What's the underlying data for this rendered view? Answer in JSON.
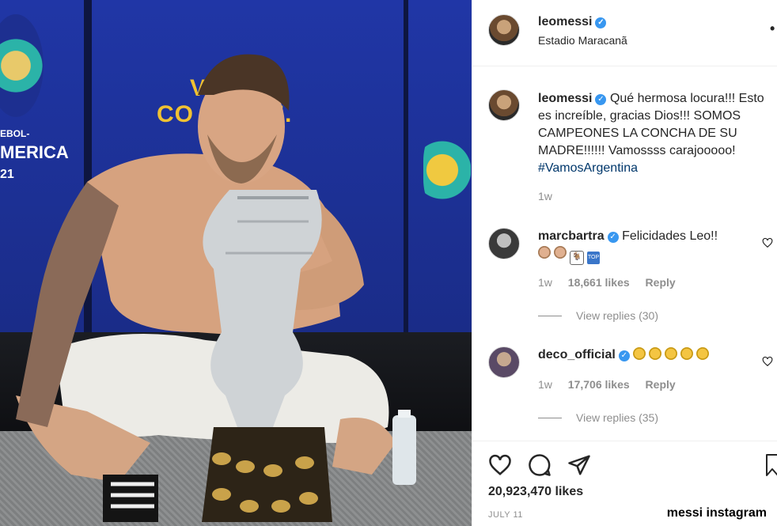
{
  "post": {
    "username": "leomessi",
    "location": "Estadio Maracanã",
    "more_glyph": "•"
  },
  "photo": {
    "banner_left": "V_",
    "banner_main": "CO        TE.",
    "logo_line1": "EBOL-",
    "logo_line2": "MERICA",
    "logo_line3": "21"
  },
  "caption": {
    "username": "leomessi",
    "text": "Qué hermosa locura!!! Esto es increíble, gracias Dios!!! SOMOS CAMPEONES LA CONCHA DE SU MADRE!!!!!! Vamossss carajooooo!",
    "hashtag": "#VamosArgentina",
    "age": "1w"
  },
  "comments": [
    {
      "username": "marcbartra",
      "text": "Felicidades Leo!!",
      "age": "1w",
      "likes": "18,661 likes",
      "reply": "Reply",
      "view_replies": "View replies (30)"
    },
    {
      "username": "deco_official",
      "text": "",
      "age": "1w",
      "likes": "17,706 likes",
      "reply": "Reply",
      "view_replies": "View replies (35)"
    }
  ],
  "icons": {
    "heart": "heart-icon",
    "comment": "comment-icon",
    "share": "share-icon",
    "save": "save-icon",
    "verified": "verified-icon"
  },
  "colors": {
    "verified": "#3897f0",
    "hashtag": "#00376b",
    "muted": "#8e8e8e"
  },
  "footer": {
    "likes": "20,923,470 likes",
    "date": "JULY 11",
    "watermark": "messi instagram"
  }
}
